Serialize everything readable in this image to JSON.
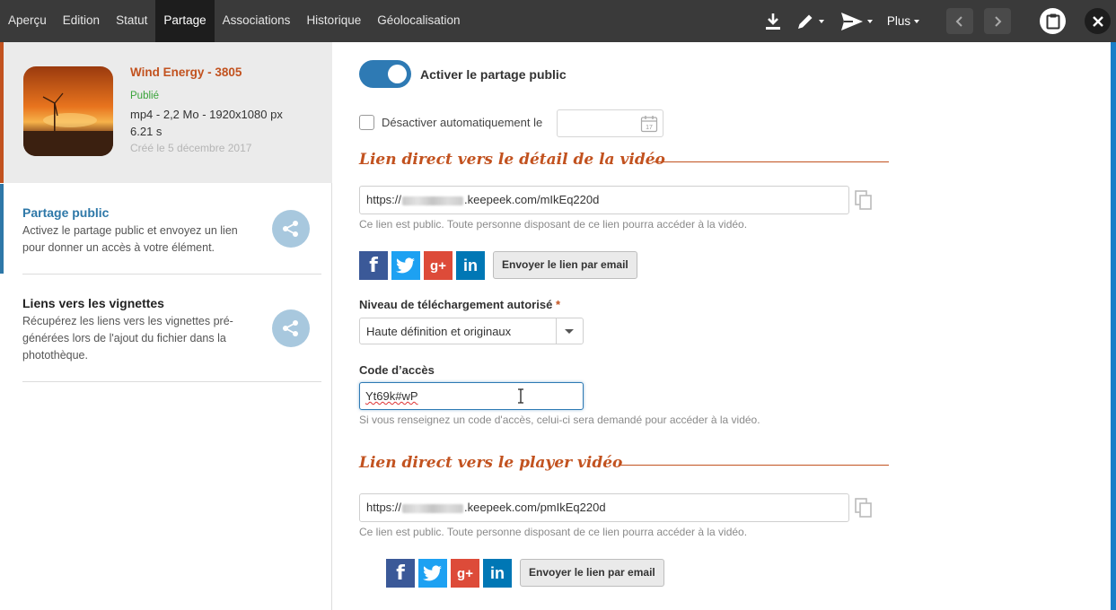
{
  "tabs": [
    "Aperçu",
    "Edition",
    "Statut",
    "Partage",
    "Associations",
    "Historique",
    "Géolocalisation"
  ],
  "active_tab": "Partage",
  "toolbar": {
    "more_label": "Plus"
  },
  "media": {
    "title": "Wind Energy - 3805",
    "status": "Publié",
    "format": "mp4 - 2,2 Mo - 1920x1080 px",
    "duration": "6.21 s",
    "created": "Créé le 5 décembre 2017"
  },
  "sidebar": {
    "items": [
      {
        "title": "Partage public",
        "desc": "Activez le partage public et envoyez un lien pour donner un accès à votre élément."
      },
      {
        "title": "Liens vers les vignettes",
        "desc": "Récupérez les liens vers les vignettes pré-générées lors de l'ajout du fichier dans la photothèque."
      }
    ]
  },
  "sharing": {
    "toggle_label": "Activer le partage public",
    "toggle_on": true,
    "auto_disable_label": "Désactiver automatiquement le",
    "calendar_day": "17",
    "detail_section_title": "Lien direct vers le détail de la vidéo",
    "detail_url_prefix": "https://",
    "detail_url_suffix": ".keepeek.com/mIkEq220d",
    "public_hint": "Ce lien est public. Toute personne disposant de ce lien pourra accéder à la vidéo.",
    "email_button": "Envoyer le lien par email",
    "download_level_label": "Niveau de téléchargement autorisé",
    "required_mark": "*",
    "download_level_value": "Haute définition et originaux",
    "access_code_label": "Code d’accès",
    "access_code_value": "Yt69k#wP",
    "access_code_hint": "Si vous renseignez un code d'accès, celui-ci sera demandé pour accéder à la vidéo.",
    "player_section_title": "Lien direct vers le player vidéo",
    "player_url_prefix": "https://",
    "player_url_suffix": ".keepeek.com/pmIkEq220d"
  },
  "social": {
    "facebook": "f",
    "googleplus": "g+",
    "linkedin": "in"
  },
  "colors": {
    "accent": "#c2521f",
    "primary": "#2e7ab4",
    "topbar": "#3a3a3a",
    "status_green": "#3aa33a"
  },
  "icons": [
    "download-icon",
    "pencil-icon",
    "send-icon",
    "chevron-left-icon",
    "chevron-right-icon",
    "clipboard-icon",
    "close-icon",
    "share-icon",
    "calendar-icon",
    "copy-icon",
    "text-cursor-icon"
  ]
}
